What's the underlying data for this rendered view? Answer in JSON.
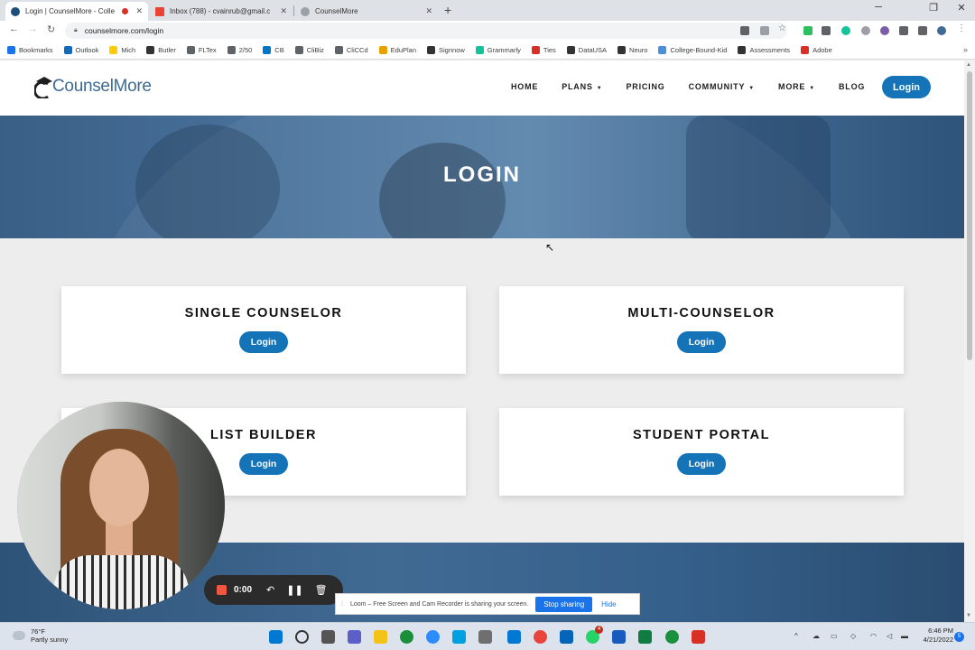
{
  "browser": {
    "tabs": [
      {
        "title": "Login | CounselMore - Colle",
        "active": true
      },
      {
        "title": "Inbox (788) - cvainrub@gmail.c",
        "active": false
      },
      {
        "title": "CounselMore",
        "active": false
      }
    ],
    "new_tab": "+",
    "window_controls": {
      "minimize": "─",
      "maximize": "❐",
      "close": "✕"
    },
    "url": "counselmore.com/login",
    "bookmarks": [
      {
        "label": "Bookmarks",
        "color": "#1a73e8"
      },
      {
        "label": "Outlook",
        "color": "#0f6cbd"
      },
      {
        "label": "Mich",
        "color": "#ffcb05"
      },
      {
        "label": "Butler",
        "color": "#333333"
      },
      {
        "label": "FLTex",
        "color": "#5f6368"
      },
      {
        "label": "2/50",
        "color": "#5f6368"
      },
      {
        "label": "CB",
        "color": "#0077c8"
      },
      {
        "label": "CliBiz",
        "color": "#5f6368"
      },
      {
        "label": "CliCCd",
        "color": "#5f6368"
      },
      {
        "label": "EduPlan",
        "color": "#e8a200"
      },
      {
        "label": "Signnow",
        "color": "#333333"
      },
      {
        "label": "Grammarly",
        "color": "#15c39a"
      },
      {
        "label": "Ties",
        "color": "#d93025"
      },
      {
        "label": "DataUSA",
        "color": "#333333"
      },
      {
        "label": "Neuro",
        "color": "#333333"
      },
      {
        "label": "College-Bound-Kid",
        "color": "#4a90d9"
      },
      {
        "label": "Assessments",
        "color": "#333333"
      },
      {
        "label": "Adobe",
        "color": "#d93025"
      }
    ]
  },
  "site": {
    "logo_text": "CounselMore",
    "nav": [
      {
        "label": "HOME",
        "dropdown": false
      },
      {
        "label": "PLANS",
        "dropdown": true
      },
      {
        "label": "PRICING",
        "dropdown": false
      },
      {
        "label": "COMMUNITY",
        "dropdown": true
      },
      {
        "label": "MORE",
        "dropdown": true
      },
      {
        "label": "BLOG",
        "dropdown": false
      }
    ],
    "header_login": "Login",
    "hero_title": "LOGIN",
    "cards": [
      {
        "title": "SINGLE COUNSELOR",
        "button": "Login"
      },
      {
        "title": "MULTI-COUNSELOR",
        "button": "Login"
      },
      {
        "title": "LIST BUILDER",
        "button": "Login"
      },
      {
        "title": "STUDENT PORTAL",
        "button": "Login"
      }
    ],
    "accent_color": "#1573b8"
  },
  "loom": {
    "timer": "0:00",
    "share_message": "Loom – Free Screen and Cam Recorder is sharing your screen.",
    "stop_sharing": "Stop sharing",
    "hide": "Hide"
  },
  "taskbar": {
    "temperature": "76°F",
    "weather": "Partly sunny",
    "time": "6:46 PM",
    "date": "4/21/2022",
    "badge_count": "4",
    "notification_count": "5"
  }
}
